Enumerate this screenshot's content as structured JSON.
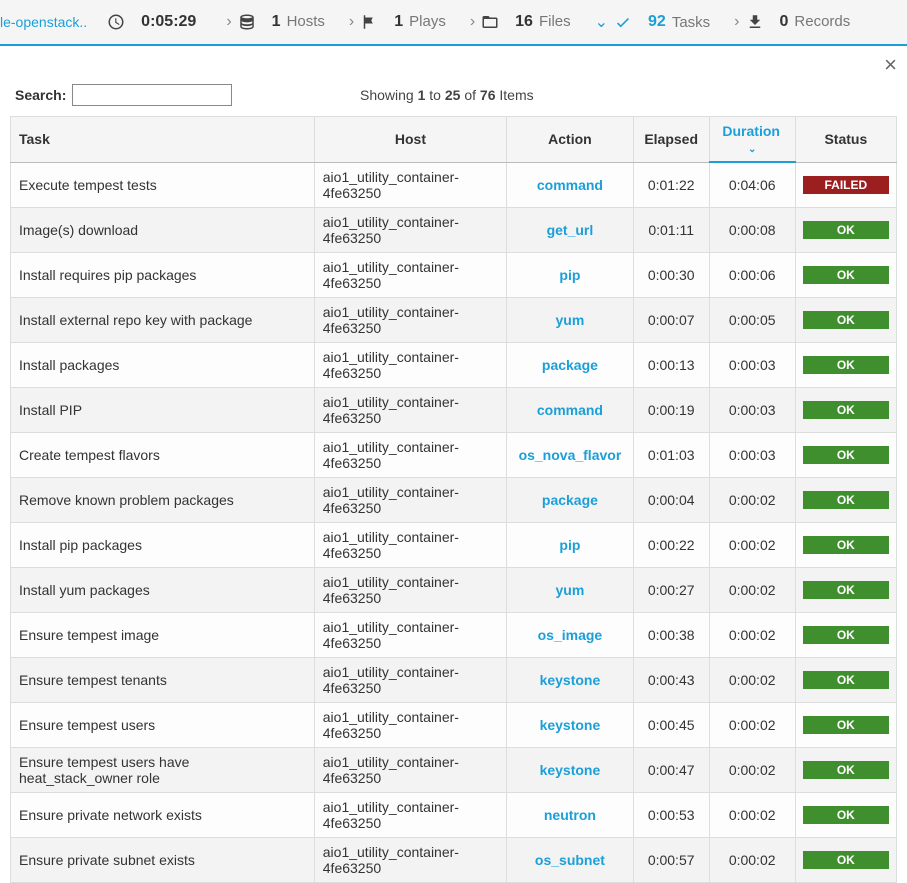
{
  "topbar": {
    "breadcrumb": "le-openstack..",
    "time": "0:05:29",
    "hosts": {
      "count": "1",
      "label": "Hosts"
    },
    "plays": {
      "count": "1",
      "label": "Plays"
    },
    "files": {
      "count": "16",
      "label": "Files"
    },
    "tasks": {
      "count": "92",
      "label": "Tasks"
    },
    "records": {
      "count": "0",
      "label": "Records"
    }
  },
  "toolbar": {
    "search_label": "Search:",
    "search_value": "",
    "showing_prefix": "Showing ",
    "showing_from": "1",
    "showing_to_word": " to ",
    "showing_to": "25",
    "showing_of_word": " of ",
    "showing_total": "76",
    "showing_suffix": " Items"
  },
  "columns": {
    "task": "Task",
    "host": "Host",
    "action": "Action",
    "elapsed": "Elapsed",
    "duration": "Duration",
    "status": "Status"
  },
  "rows": [
    {
      "task": "Execute tempest tests",
      "host": "aio1_utility_container-4fe63250",
      "action": "command",
      "elapsed": "0:01:22",
      "duration": "0:04:06",
      "status": "FAILED"
    },
    {
      "task": "Image(s) download",
      "host": "aio1_utility_container-4fe63250",
      "action": "get_url",
      "elapsed": "0:01:11",
      "duration": "0:00:08",
      "status": "OK"
    },
    {
      "task": "Install requires pip packages",
      "host": "aio1_utility_container-4fe63250",
      "action": "pip",
      "elapsed": "0:00:30",
      "duration": "0:00:06",
      "status": "OK"
    },
    {
      "task": "Install external repo key with package",
      "host": "aio1_utility_container-4fe63250",
      "action": "yum",
      "elapsed": "0:00:07",
      "duration": "0:00:05",
      "status": "OK"
    },
    {
      "task": "Install packages",
      "host": "aio1_utility_container-4fe63250",
      "action": "package",
      "elapsed": "0:00:13",
      "duration": "0:00:03",
      "status": "OK"
    },
    {
      "task": "Install PIP",
      "host": "aio1_utility_container-4fe63250",
      "action": "command",
      "elapsed": "0:00:19",
      "duration": "0:00:03",
      "status": "OK"
    },
    {
      "task": "Create tempest flavors",
      "host": "aio1_utility_container-4fe63250",
      "action": "os_nova_flavor",
      "elapsed": "0:01:03",
      "duration": "0:00:03",
      "status": "OK"
    },
    {
      "task": "Remove known problem packages",
      "host": "aio1_utility_container-4fe63250",
      "action": "package",
      "elapsed": "0:00:04",
      "duration": "0:00:02",
      "status": "OK"
    },
    {
      "task": "Install pip packages",
      "host": "aio1_utility_container-4fe63250",
      "action": "pip",
      "elapsed": "0:00:22",
      "duration": "0:00:02",
      "status": "OK"
    },
    {
      "task": "Install yum packages",
      "host": "aio1_utility_container-4fe63250",
      "action": "yum",
      "elapsed": "0:00:27",
      "duration": "0:00:02",
      "status": "OK"
    },
    {
      "task": "Ensure tempest image",
      "host": "aio1_utility_container-4fe63250",
      "action": "os_image",
      "elapsed": "0:00:38",
      "duration": "0:00:02",
      "status": "OK"
    },
    {
      "task": "Ensure tempest tenants",
      "host": "aio1_utility_container-4fe63250",
      "action": "keystone",
      "elapsed": "0:00:43",
      "duration": "0:00:02",
      "status": "OK"
    },
    {
      "task": "Ensure tempest users",
      "host": "aio1_utility_container-4fe63250",
      "action": "keystone",
      "elapsed": "0:00:45",
      "duration": "0:00:02",
      "status": "OK"
    },
    {
      "task": "Ensure tempest users have heat_stack_owner role",
      "host": "aio1_utility_container-4fe63250",
      "action": "keystone",
      "elapsed": "0:00:47",
      "duration": "0:00:02",
      "status": "OK"
    },
    {
      "task": "Ensure private network exists",
      "host": "aio1_utility_container-4fe63250",
      "action": "neutron",
      "elapsed": "0:00:53",
      "duration": "0:00:02",
      "status": "OK"
    },
    {
      "task": "Ensure private subnet exists",
      "host": "aio1_utility_container-4fe63250",
      "action": "os_subnet",
      "elapsed": "0:00:57",
      "duration": "0:00:02",
      "status": "OK"
    }
  ]
}
